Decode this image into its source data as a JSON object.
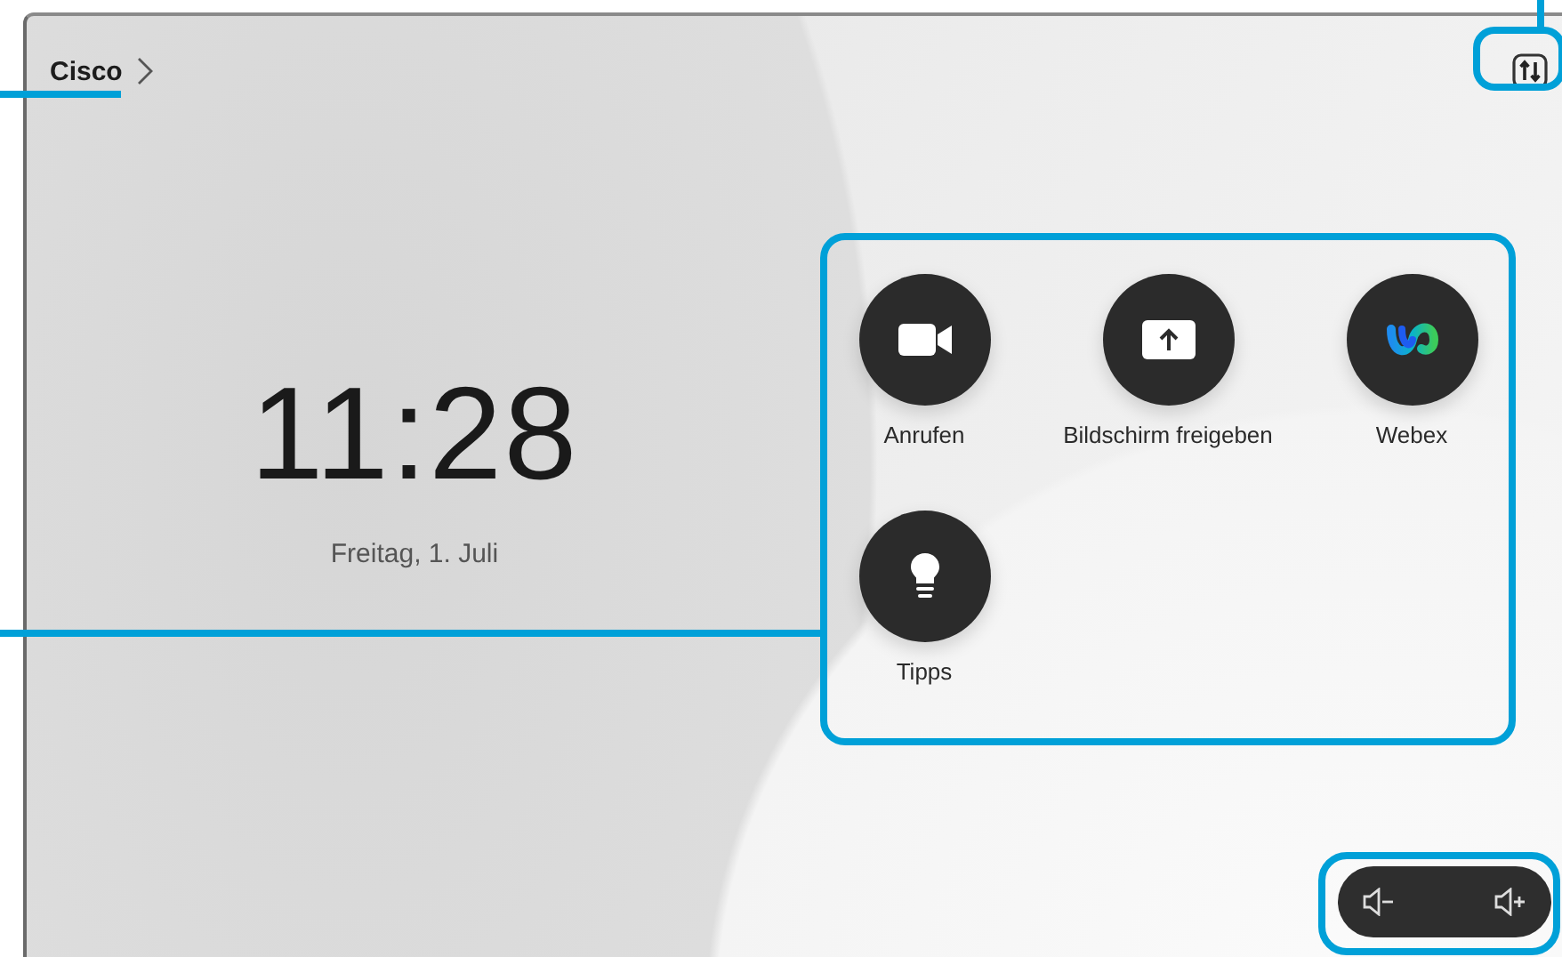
{
  "header": {
    "title": "Cisco"
  },
  "clock": {
    "time": "11:28",
    "date": "Freitag, 1. Juli"
  },
  "apps": [
    {
      "label": "Anrufen",
      "kind": "call"
    },
    {
      "label": "Bildschirm freigeben",
      "kind": "share"
    },
    {
      "label": "Webex",
      "kind": "webex"
    },
    {
      "label": "Tipps",
      "kind": "tips"
    }
  ]
}
